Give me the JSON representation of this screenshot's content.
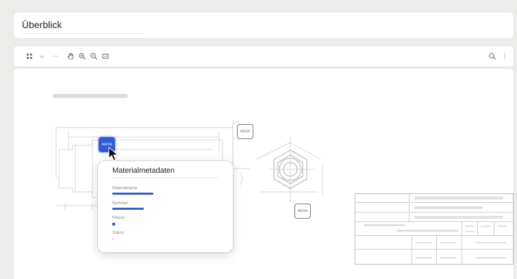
{
  "window": {
    "title": "Überblick"
  },
  "toolbar": {
    "left_icons": [
      "grid-icon",
      "chevron-down-icon",
      "arrow-icon",
      "hand-icon",
      "zoom-in-icon",
      "zoom-out-icon",
      "fit-icon"
    ],
    "right_icons": [
      "search-icon",
      "more-icon"
    ]
  },
  "drawing": {
    "tags": [
      {
        "label": "MBDDB",
        "state": "active"
      },
      {
        "label": "MBDDC",
        "state": "normal"
      },
      {
        "label": "MBDDA",
        "state": "normal"
      }
    ]
  },
  "popup": {
    "title": "Materialmetadaten",
    "fields": [
      {
        "label": "Materialname",
        "value_fraction": 1.0
      },
      {
        "label": "Nummer",
        "value_fraction": 0.77
      },
      {
        "label": "Klasse",
        "value_fraction": 0.07
      },
      {
        "label": "Status",
        "value_fraction": 0.03
      }
    ]
  },
  "colors": {
    "accent": "#2f5bd8",
    "background": "#ececea",
    "panel": "#ffffff",
    "placeholder": "#dcdcdc"
  }
}
